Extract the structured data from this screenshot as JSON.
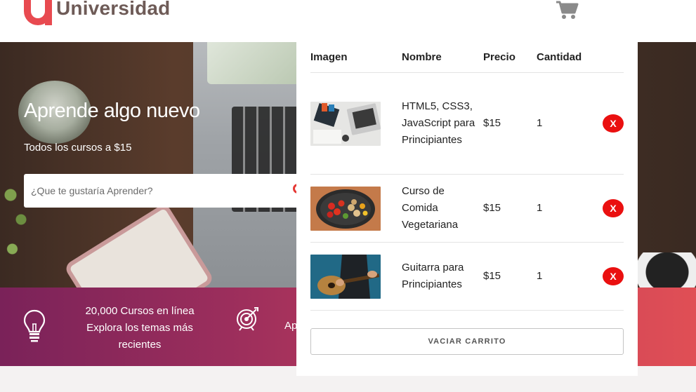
{
  "header": {
    "logo_letter": "u",
    "logo_text": "Universidad",
    "cart_icon": "shopping-cart-icon"
  },
  "hero": {
    "title": "Aprende algo nuevo",
    "subtitle": "Todos los cursos a $15",
    "search_placeholder": "¿Que te gustaría Aprender?",
    "search_icon": "search-icon"
  },
  "features": {
    "item1": {
      "icon": "lightbulb-icon",
      "line1": "20,000 Cursos en línea",
      "line2": "Explora los temas más",
      "line3": "recientes"
    },
    "item2": {
      "icon": "target-icon",
      "partial_text": "Ap"
    }
  },
  "cart": {
    "headers": {
      "image": "Imagen",
      "name": "Nombre",
      "price": "Precio",
      "quantity": "Cantidad"
    },
    "items": [
      {
        "name": "HTML5, CSS3, JavaScript para Principiantes",
        "price": "$15",
        "quantity": "1",
        "remove": "X",
        "thumb": "laptop-desk-photo"
      },
      {
        "name": "Curso de Comida Vegetariana",
        "price": "$15",
        "quantity": "1",
        "remove": "X",
        "thumb": "vegetables-pan-photo"
      },
      {
        "name": "Guitarra para Principiantes",
        "price": "$15",
        "quantity": "1",
        "remove": "X",
        "thumb": "guitar-player-photo"
      }
    ],
    "empty_button": "VACIAR CARRITO"
  },
  "colors": {
    "brand": "#e84a50",
    "remove": "#ea1010",
    "feature_gradient_start": "#7a2259",
    "feature_gradient_end": "#e04f55"
  }
}
